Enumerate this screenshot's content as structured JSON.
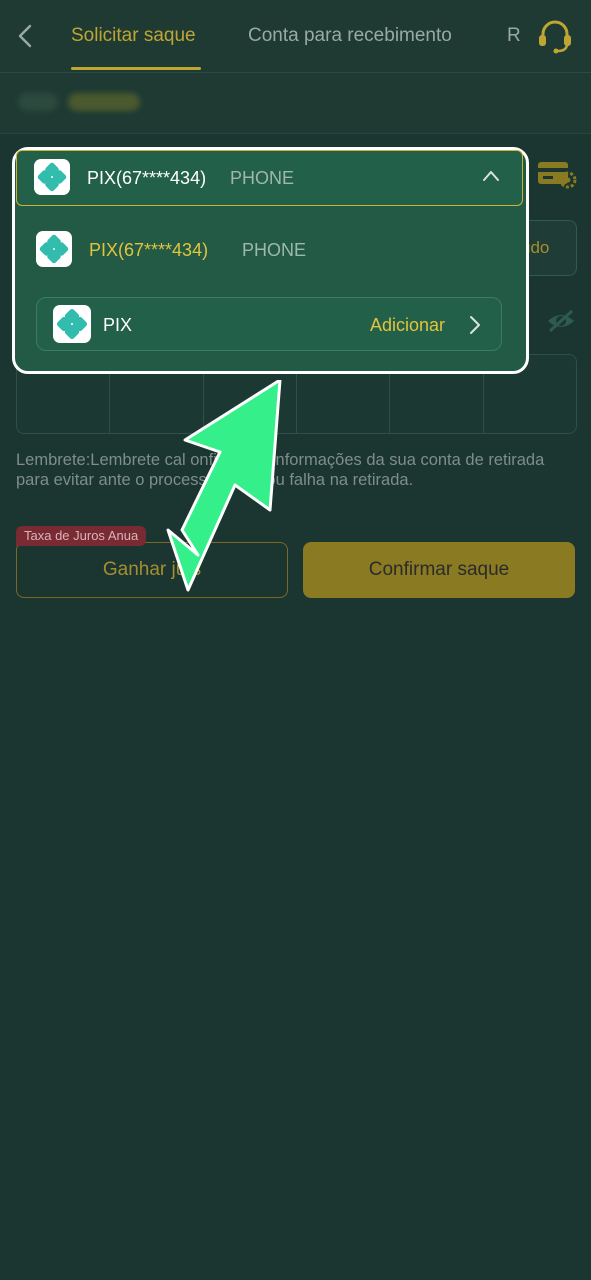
{
  "header": {
    "tabs": [
      {
        "label": "Solicitar saque"
      },
      {
        "label": "Conta para recebimento"
      },
      {
        "label": "R"
      }
    ]
  },
  "form": {
    "amount_button": "udo",
    "reminder": "Lembrete:Lembrete cal    onfirme as informações da sua conta de retirada para evitar      ante o processamento ou falha na retirada.",
    "rate_badge": "Taxa de Juros Anua",
    "earn_button": "Ganhar ju    s",
    "confirm_button": "Confirmar saque"
  },
  "dropdown": {
    "selected": {
      "name": "PIX(67****434)",
      "type": "PHONE"
    },
    "option": {
      "name": "PIX(67****434)",
      "type": "PHONE"
    },
    "add_row": {
      "name": "PIX",
      "action": "Adicionar"
    }
  },
  "colors": {
    "accent": "#cdb238",
    "background": "#1b3530",
    "popup": "#225a46",
    "arrow": "#35f08a",
    "pix_logo": "#32bcad"
  }
}
